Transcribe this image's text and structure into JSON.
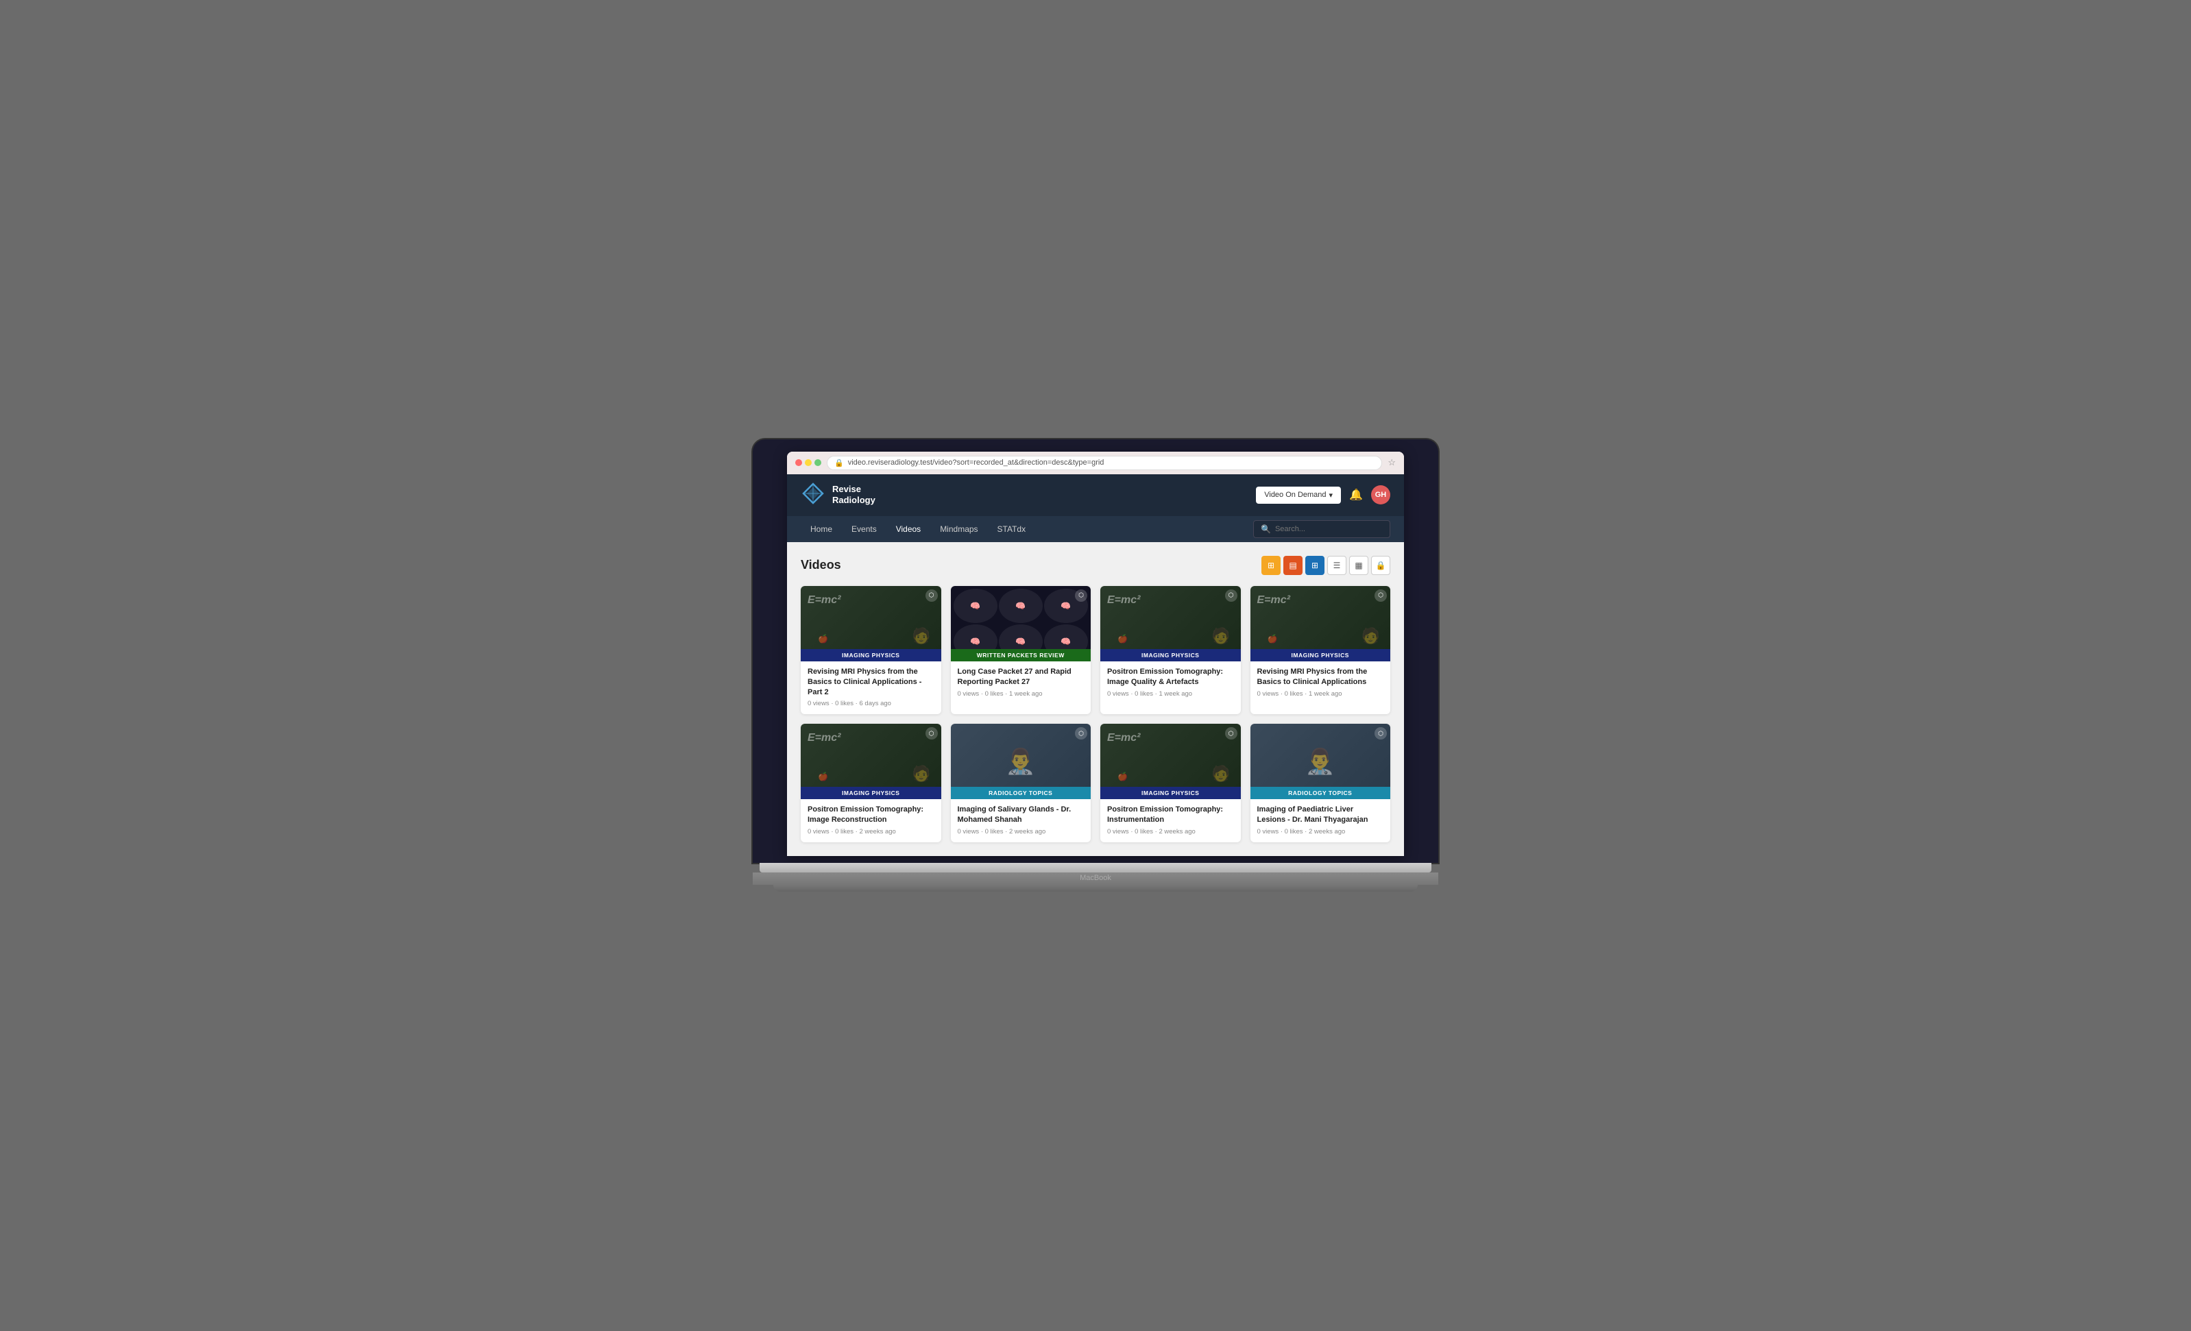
{
  "browser": {
    "url": "video.reviseradiology.test/video?sort=recorded_at&direction=desc&type=grid"
  },
  "site": {
    "logo_text_line1": "Revise",
    "logo_text_line2": "Radiology",
    "vod_label": "Video On Demand",
    "nav_items": [
      {
        "label": "Home"
      },
      {
        "label": "Events"
      },
      {
        "label": "Videos"
      },
      {
        "label": "Mindmaps"
      },
      {
        "label": "STATdx"
      }
    ],
    "search_placeholder": "Search...",
    "user_initials": "GH"
  },
  "page": {
    "title": "Videos"
  },
  "videos": [
    {
      "id": 1,
      "category": "IMAGING PHYSICS",
      "category_class": "cat-imaging-physics",
      "thumb_class": "thumb-physics",
      "thumb_type": "blackboard",
      "title": "Revising MRI Physics from the Basics to Clinical Applications - Part 2",
      "meta": "0 views · 0 likes · 6 days ago"
    },
    {
      "id": 2,
      "category": "WRITTEN PACKETS REVIEW",
      "category_class": "cat-written-packets",
      "thumb_class": "thumb-written",
      "thumb_type": "brain_scan",
      "title": "Long Case Packet 27 and Rapid Reporting Packet 27",
      "meta": "0 views · 0 likes · 1 week ago"
    },
    {
      "id": 3,
      "category": "IMAGING PHYSICS",
      "category_class": "cat-imaging-physics",
      "thumb_class": "thumb-physics",
      "thumb_type": "blackboard",
      "title": "Positron Emission Tomography: Image Quality & Artefacts",
      "meta": "0 views · 0 likes · 1 week ago"
    },
    {
      "id": 4,
      "category": "IMAGING PHYSICS",
      "category_class": "cat-imaging-physics",
      "thumb_class": "thumb-physics",
      "thumb_type": "blackboard",
      "title": "Revising MRI Physics from the Basics to Clinical Applications",
      "meta": "0 views · 0 likes · 1 week ago"
    },
    {
      "id": 5,
      "category": "IMAGING PHYSICS",
      "category_class": "cat-imaging-physics",
      "thumb_class": "thumb-physics",
      "thumb_type": "blackboard",
      "title": "Positron Emission Tomography: Image Reconstruction",
      "meta": "0 views · 0 likes · 2 weeks ago"
    },
    {
      "id": 6,
      "category": "RADIOLOGY TOPICS",
      "category_class": "cat-radiology-topics",
      "thumb_class": "thumb-salivary",
      "thumb_type": "doctor",
      "title": "Imaging of Salivary Glands - Dr. Mohamed Shanah",
      "meta": "0 views · 0 likes · 2 weeks ago"
    },
    {
      "id": 7,
      "category": "IMAGING PHYSICS",
      "category_class": "cat-imaging-physics",
      "thumb_class": "thumb-physics",
      "thumb_type": "blackboard",
      "title": "Positron Emission Tomography: Instrumentation",
      "meta": "0 views · 0 likes · 2 weeks ago"
    },
    {
      "id": 8,
      "category": "RADIOLOGY TOPICS",
      "category_class": "cat-radiology-topics",
      "thumb_class": "thumb-liver",
      "thumb_type": "doctor",
      "title": "Imaging of Paediatric Liver Lesions - Dr. Mani Thyagarajan",
      "meta": "0 views · 0 likes · 2 weeks ago"
    }
  ]
}
